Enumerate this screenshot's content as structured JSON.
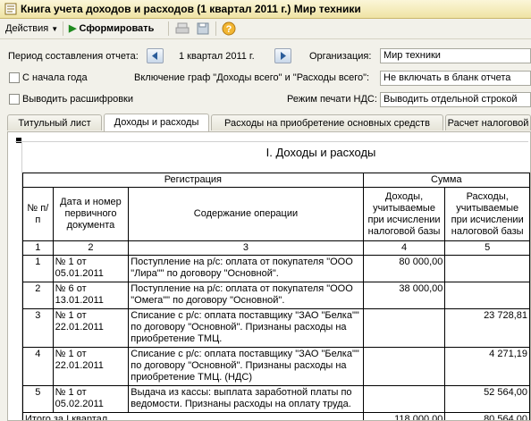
{
  "window": {
    "title": "Книга учета доходов и расходов (1 квартал 2011 г.) Мир техники"
  },
  "toolbar": {
    "actions_label": "Действия",
    "generate_label": "Сформировать"
  },
  "form": {
    "period_label": "Период составления отчета:",
    "period_value": "1 квартал 2011 г.",
    "org_label": "Организация:",
    "org_value": "Мир техники",
    "from_year_start_label": "С начала года",
    "include_totals_label": "Включение граф \"Доходы всего\" и \"Расходы всего\":",
    "include_totals_value": "Не включать в бланк отчета",
    "show_breakdown_label": "Выводить расшифровки",
    "vat_mode_label": "Режим печати НДС:",
    "vat_mode_value": "Выводить отдельной строкой"
  },
  "tabs": [
    "Титульный лист",
    "Доходы и расходы",
    "Расходы на приобретение основных средств",
    "Расчет налоговой"
  ],
  "report": {
    "title": "I. Доходы и расходы",
    "head_registration": "Регистрация",
    "head_sum": "Сумма",
    "col_num": "№ п/п",
    "col_doc": "Дата и номер первичного документа",
    "col_op": "Содержание операции",
    "col_income": "Доходы, учитываемые при исчислении налоговой базы",
    "col_expense": "Расходы, учитываемые при исчислении налоговой базы",
    "col_numbers": [
      "1",
      "2",
      "3",
      "4",
      "5"
    ],
    "rows": [
      {
        "n": "1",
        "doc": "№ 1 от 05.01.2011",
        "op": "Поступление на р/с: оплата от покупателя \"ООО \"Лира\"\" по договору \"Основной\".",
        "income": "80 000,00",
        "expense": ""
      },
      {
        "n": "2",
        "doc": "№ 6 от 13.01.2011",
        "op": "Поступление на р/с: оплата от покупателя \"ООО \"Омега\"\" по договору \"Основной\".",
        "income": "38 000,00",
        "expense": ""
      },
      {
        "n": "3",
        "doc": "№ 1 от 22.01.2011",
        "op": "Списание с р/с: оплата поставщику \"ЗАО \"Белка\"\" по договору \"Основной\". Признаны расходы на приобретение ТМЦ.",
        "income": "",
        "expense": "23 728,81"
      },
      {
        "n": "4",
        "doc": "№ 1 от 22.01.2011",
        "op": "Списание с р/с: оплата поставщику \"ЗАО \"Белка\"\" по договору \"Основной\". Признаны расходы на приобретение ТМЦ. (НДС)",
        "income": "",
        "expense": "4 271,19"
      },
      {
        "n": "5",
        "doc": "№ 1 от 05.02.2011",
        "op": "Выдача из кассы: выплата заработной платы по ведомости. Признаны расходы на оплату труда.",
        "income": "",
        "expense": "52 564,00"
      }
    ],
    "total_label": "Итого за I квартал",
    "total_income": "118 000,00",
    "total_expense": "80 564,00"
  }
}
